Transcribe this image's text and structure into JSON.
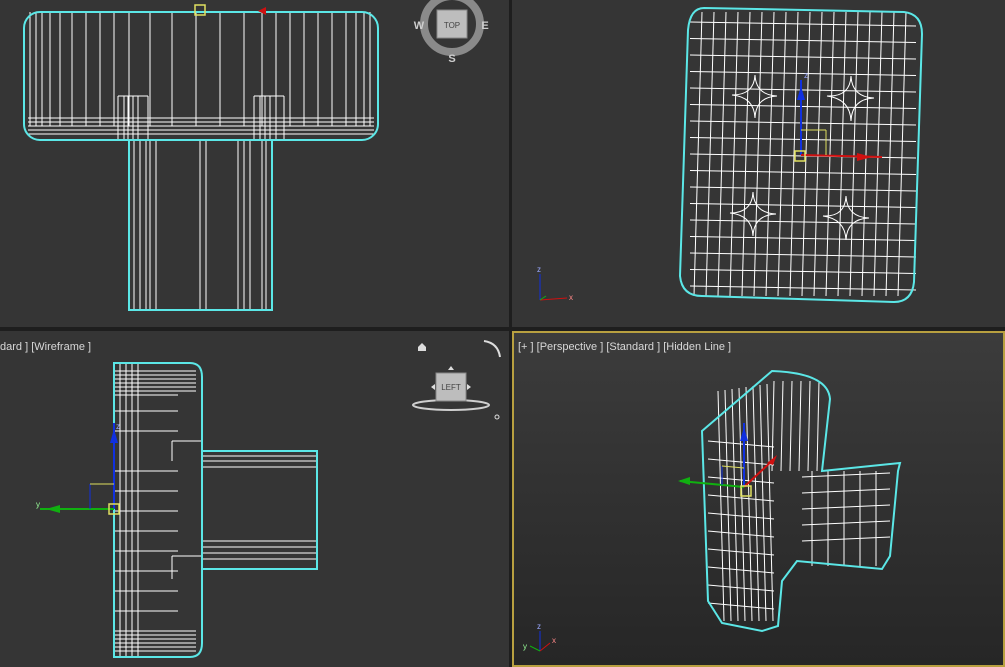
{
  "viewports": {
    "top": {
      "compass": {
        "cube_label": "TOP",
        "west": "W",
        "east": "E",
        "south": "S"
      }
    },
    "front": {
      "axes": {
        "z": "z",
        "x": "x"
      }
    },
    "left": {
      "label_parts": [
        "dard ]",
        " [Wireframe ]"
      ],
      "viewcube_label": "LEFT",
      "axes": {
        "z": "z",
        "y": "y"
      }
    },
    "perspective": {
      "label_parts": [
        "[+ ]",
        " [Perspective ]",
        " [Standard ]",
        " [Hidden Line ]"
      ],
      "axes": {
        "z": "z",
        "x": "x",
        "y": "y"
      }
    }
  },
  "colors": {
    "selection": "#5be7e7",
    "wire": "#ffffff",
    "axis_x": "#d01010",
    "axis_y": "#10b010",
    "axis_z": "#1030e0",
    "pivot": "#e0e060",
    "active_border": "#b8a040"
  }
}
